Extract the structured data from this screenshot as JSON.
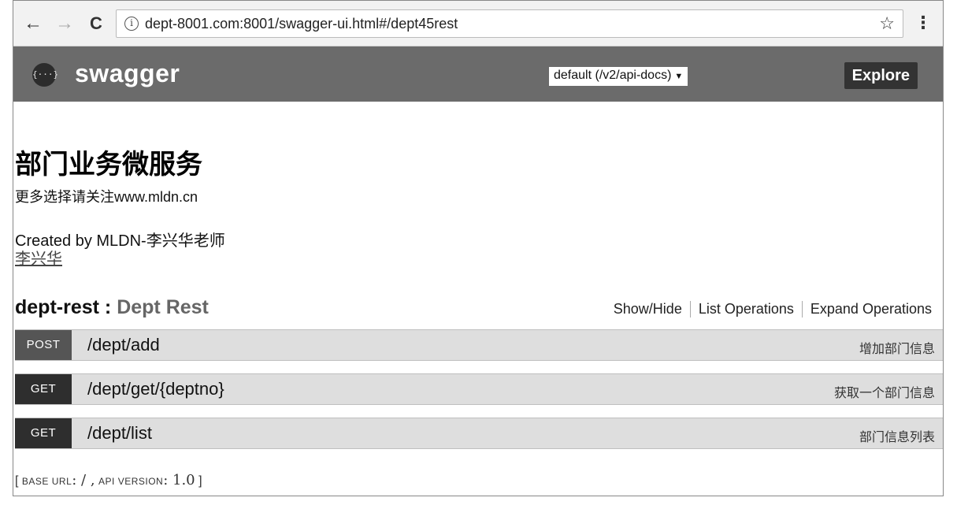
{
  "browser": {
    "back_glyph": "←",
    "forward_glyph": "→",
    "reload_glyph": "C",
    "info_glyph": "i",
    "url": "dept-8001.com:8001/swagger-ui.html#/dept45rest",
    "star_glyph": "☆",
    "menu_glyph": "⋮",
    "icons": [
      "back-arrow-icon",
      "forward-arrow-icon",
      "reload-icon",
      "info-icon",
      "star-icon",
      "more-vert-icon"
    ]
  },
  "header": {
    "logo_glyph": "{···}",
    "logo_text": "swagger",
    "api_select_value": "default (/v2/api-docs)",
    "api_select_caret": "▼",
    "explore_label": "Explore",
    "colors": {
      "header_bg": "#6b6b6b",
      "explore_bg": "#333333"
    }
  },
  "info": {
    "title": "部门业务微服务",
    "description": "更多选择请关注www.mldn.cn",
    "created_by": "Created by MLDN-李兴华老师",
    "contact_link": "李兴华"
  },
  "resource": {
    "name": "dept-rest",
    "separator": " : ",
    "description": "Dept Rest",
    "actions": [
      "Show/Hide",
      "List Operations",
      "Expand Operations"
    ]
  },
  "operations": [
    {
      "method": "POST",
      "path": "/dept/add",
      "summary": "增加部门信息"
    },
    {
      "method": "GET",
      "path": "/dept/get/{deptno}",
      "summary": "获取一个部门信息"
    },
    {
      "method": "GET",
      "path": "/dept/list",
      "summary": "部门信息列表"
    }
  ],
  "footer": {
    "open": "[",
    "base_url_label": "BASE URL",
    "base_url_value": ": / ,",
    "api_version_label": "API VERSION",
    "api_version_value": ": 1.0",
    "close": "]"
  }
}
